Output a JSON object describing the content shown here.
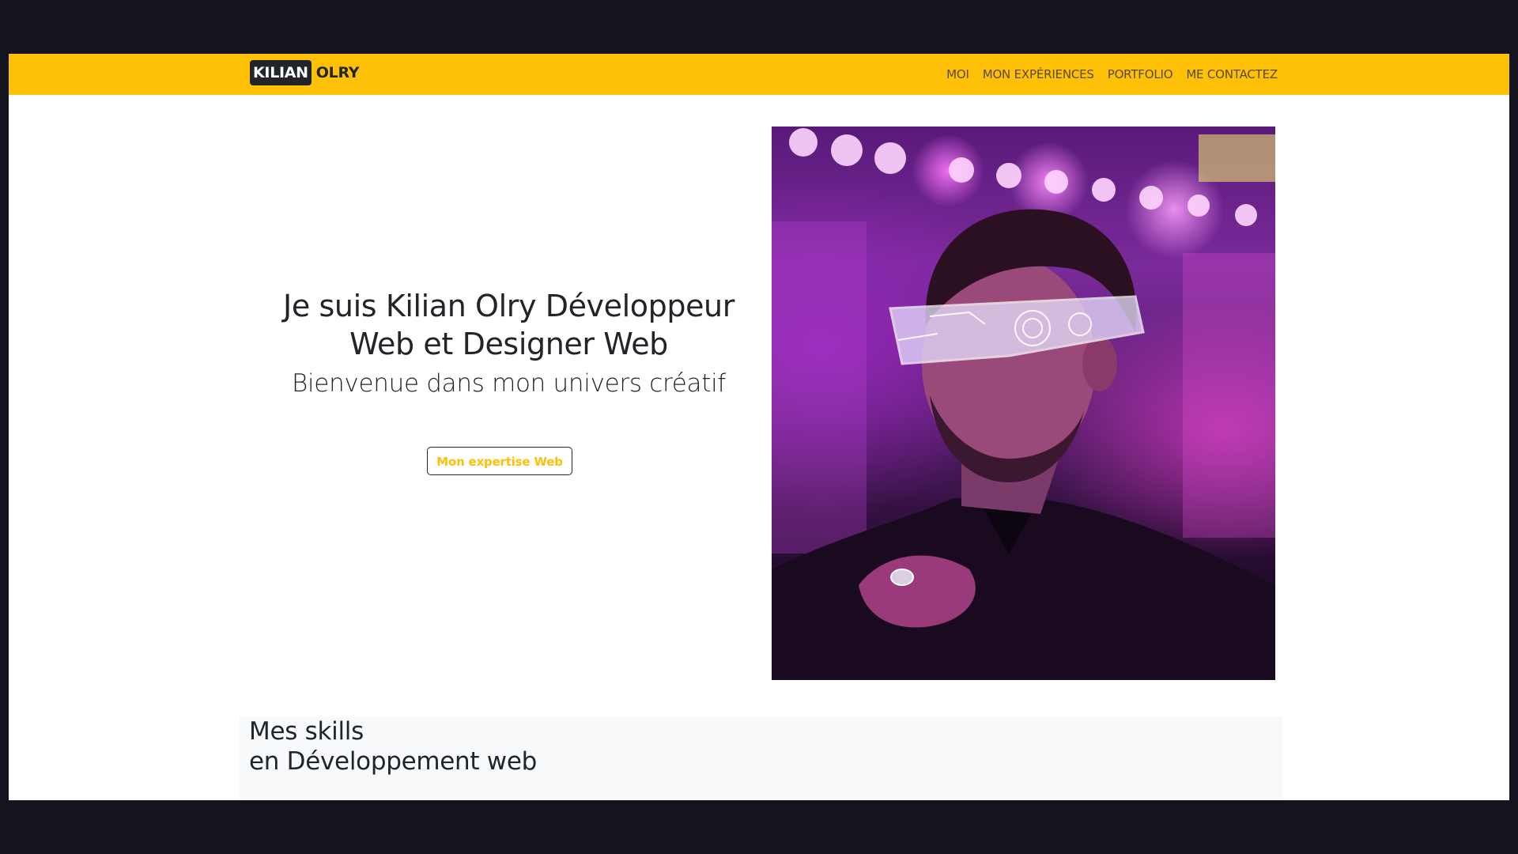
{
  "colors": {
    "accent": "#ffc107",
    "dark": "#212529",
    "background_outer": "#14141f"
  },
  "navbar": {
    "brand_first": "KILIAN",
    "brand_second": "OLRY",
    "links": [
      {
        "label": "MOI"
      },
      {
        "label": "MON EXPÉRIENCES"
      },
      {
        "label": "PORTFOLIO"
      },
      {
        "label": "ME CONTACTEZ"
      }
    ]
  },
  "hero": {
    "title": "Je suis Kilian Olry Développeur Web et Designer Web",
    "subtitle": "Bienvenue dans mon univers créatif",
    "button_label": "Mon expertise Web",
    "image_icon": "portrait-photo-icon"
  },
  "skills": {
    "title_line1": "Mes skills",
    "title_line2": "en Développement web"
  }
}
